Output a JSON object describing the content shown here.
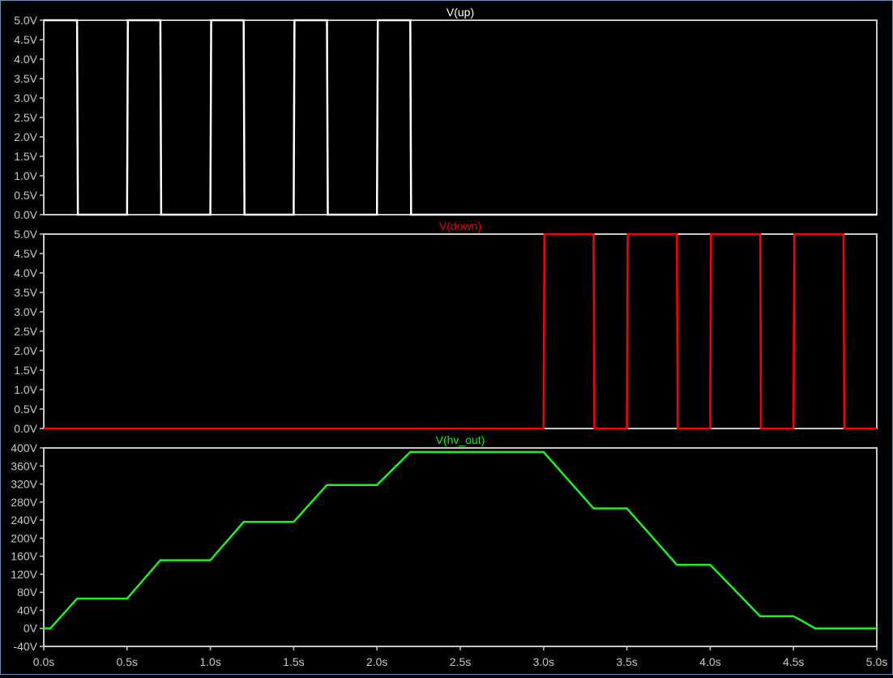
{
  "colors": {
    "background": "#000000",
    "frame": "#c8c8c8",
    "gridline": "#555555",
    "axis_text": "#c8c8c8"
  },
  "chart_data": [
    {
      "type": "line",
      "title": "V(up)",
      "title_color": "#ffffff",
      "line_color": "#ffffff",
      "ylim": [
        0,
        5
      ],
      "yticks": [
        0,
        0.5,
        1,
        1.5,
        2,
        2.5,
        3,
        3.5,
        4,
        4.5,
        5
      ],
      "ytick_labels": [
        "0.0V",
        "0.5V",
        "1.0V",
        "1.5V",
        "2.0V",
        "2.5V",
        "3.0V",
        "3.5V",
        "4.0V",
        "4.5V",
        "5.0V"
      ],
      "xlim": [
        0,
        5
      ],
      "series": [
        {
          "x": [
            0,
            0.2,
            0.205,
            0.5,
            0.505,
            0.7,
            0.705,
            1.0,
            1.005,
            1.2,
            1.205,
            1.5,
            1.505,
            1.7,
            1.705,
            2.0,
            2.005,
            2.2,
            2.205,
            5.0
          ],
          "values": [
            5,
            5,
            0,
            0,
            5,
            5,
            0,
            0,
            5,
            5,
            0,
            0,
            5,
            5,
            0,
            0,
            5,
            5,
            0,
            0
          ]
        }
      ]
    },
    {
      "type": "line",
      "title": "V(down)",
      "title_color": "#ff0000",
      "line_color": "#ff0000",
      "ylim": [
        0,
        5
      ],
      "yticks": [
        0,
        0.5,
        1,
        1.5,
        2,
        2.5,
        3,
        3.5,
        4,
        4.5,
        5
      ],
      "ytick_labels": [
        "0.0V",
        "0.5V",
        "1.0V",
        "1.5V",
        "2.0V",
        "2.5V",
        "3.0V",
        "3.5V",
        "4.0V",
        "4.5V",
        "5.0V"
      ],
      "xlim": [
        0,
        5
      ],
      "series": [
        {
          "x": [
            0,
            3.0,
            3.005,
            3.3,
            3.305,
            3.5,
            3.505,
            3.8,
            3.805,
            4.0,
            4.005,
            4.3,
            4.305,
            4.5,
            4.505,
            4.8,
            4.805,
            5.0
          ],
          "values": [
            0,
            0,
            5,
            5,
            0,
            0,
            5,
            5,
            0,
            0,
            5,
            5,
            0,
            0,
            5,
            5,
            0,
            0
          ]
        }
      ]
    },
    {
      "type": "line",
      "title": "V(hv_out)",
      "title_color": "#00ff00",
      "line_color": "#22ee22",
      "ylim": [
        -40,
        400
      ],
      "yticks": [
        -40,
        0,
        40,
        80,
        120,
        160,
        200,
        240,
        280,
        320,
        360,
        400
      ],
      "ytick_labels": [
        "-40V",
        "0V",
        "40V",
        "80V",
        "120V",
        "160V",
        "200V",
        "240V",
        "280V",
        "320V",
        "360V",
        "400V"
      ],
      "xlim": [
        0,
        5
      ],
      "xticks": [
        0,
        0.5,
        1,
        1.5,
        2,
        2.5,
        3,
        3.5,
        4,
        4.5,
        5
      ],
      "xtick_labels": [
        "0.0s",
        "0.5s",
        "1.0s",
        "1.5s",
        "2.0s",
        "2.5s",
        "3.0s",
        "3.5s",
        "4.0s",
        "4.5s",
        "5.0s"
      ],
      "series": [
        {
          "x": [
            0,
            0.04,
            0.2,
            0.5,
            0.7,
            1.0,
            1.2,
            1.5,
            1.7,
            2.0,
            2.2,
            3.0,
            3.3,
            3.5,
            3.8,
            4.0,
            4.3,
            4.5,
            4.55,
            4.63,
            5.0
          ],
          "values": [
            0,
            0,
            66,
            66,
            151,
            151,
            236,
            236,
            318,
            318,
            391,
            391,
            266,
            266,
            141,
            141,
            27,
            27,
            17,
            0,
            0
          ]
        }
      ]
    }
  ]
}
